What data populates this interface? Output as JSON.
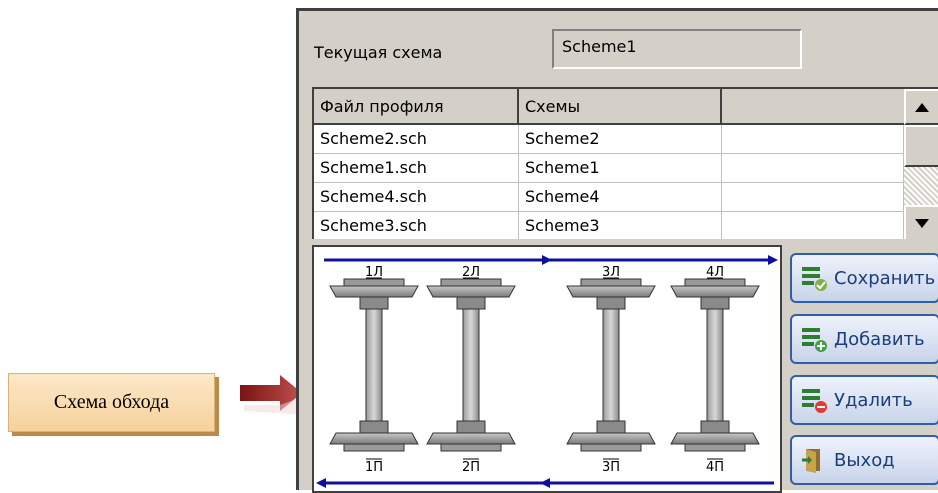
{
  "callout": {
    "label": "Схема обхода"
  },
  "current": {
    "label": "Текущая схема",
    "value": "Scheme1"
  },
  "table": {
    "headers": [
      "Файл профиля",
      "Схемы",
      ""
    ],
    "rows": [
      [
        "Scheme2.sch",
        "Scheme2"
      ],
      [
        "Scheme1.sch",
        "Scheme1"
      ],
      [
        "Scheme4.sch",
        "Scheme4"
      ],
      [
        "Scheme3.sch",
        "Scheme3"
      ]
    ]
  },
  "diagram": {
    "top_labels": [
      "1Л",
      "2Л",
      "3Л",
      "4Л"
    ],
    "bottom_labels": [
      "1П",
      "2П",
      "3П",
      "4П"
    ],
    "arrow_color": "#1010a0"
  },
  "buttons": {
    "save": "Сохранить",
    "add": "Добавить",
    "delete": "Удалить",
    "exit": "Выход"
  },
  "colors": {
    "panel": "#d4d0c8",
    "button_border": "#2f5fa8",
    "callout": "#f6d19c",
    "arrow": "#9b2020"
  }
}
